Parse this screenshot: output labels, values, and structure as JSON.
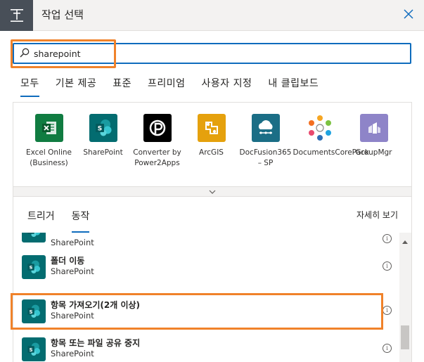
{
  "header": {
    "title": "작업 선택"
  },
  "search": {
    "value": "sharepoint"
  },
  "category_tabs": [
    {
      "label": "모두",
      "active": true
    },
    {
      "label": "기본 제공",
      "active": false
    },
    {
      "label": "표준",
      "active": false
    },
    {
      "label": "프리미엄",
      "active": false
    },
    {
      "label": "사용자 지정",
      "active": false
    },
    {
      "label": "내 클립보드",
      "active": false
    }
  ],
  "connectors": [
    {
      "name": "Excel Online (Business)",
      "icon": "excel-icon",
      "color": "#107c41"
    },
    {
      "name": "SharePoint",
      "icon": "sharepoint-icon",
      "color": "#036c70"
    },
    {
      "name": "Converter by Power2Apps",
      "icon": "power2apps-icon",
      "color": "#000000"
    },
    {
      "name": "ArcGIS",
      "icon": "arcgis-icon",
      "color": "#e5a10d"
    },
    {
      "name": "DocFusion365 – SP",
      "icon": "docfusion-icon",
      "color": "#1b6e86"
    },
    {
      "name": "DocumentsCorePack",
      "icon": "documentscorepack-icon",
      "color": "#ffffff"
    },
    {
      "name": "GroupMgr",
      "icon": "groupmgr-icon",
      "color": "#8e84c8"
    }
  ],
  "subtabs": [
    {
      "label": "트리거",
      "active": false
    },
    {
      "label": "동작",
      "active": true
    }
  ],
  "see_more": "자세히 보기",
  "actions": [
    {
      "title": "",
      "connector": "SharePoint"
    },
    {
      "title": "폴더 이동",
      "connector": "SharePoint"
    },
    {
      "title": "항목 가져오기(2개 이상)",
      "connector": "SharePoint",
      "highlighted": true
    },
    {
      "title": "항목 또는 파일 공유 중지",
      "connector": "SharePoint"
    }
  ],
  "colors": {
    "accent": "#0f6cbd",
    "highlight": "#f0822a",
    "sharepoint": "#036c70"
  }
}
